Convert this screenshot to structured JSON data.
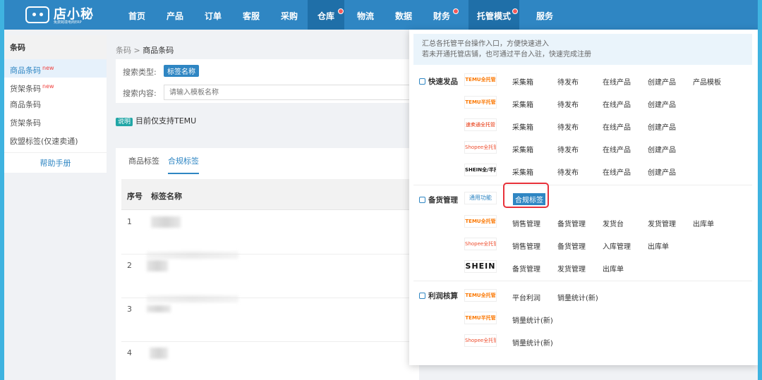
{
  "logo": {
    "name": "店小秘",
    "sub": "免费跨境电商ERP"
  },
  "nav": {
    "items": [
      {
        "label": "首页"
      },
      {
        "label": "产品"
      },
      {
        "label": "订单"
      },
      {
        "label": "客服"
      },
      {
        "label": "采购"
      },
      {
        "label": "仓库"
      },
      {
        "label": "物流"
      },
      {
        "label": "数据"
      },
      {
        "label": "财务"
      },
      {
        "label": "托管模式"
      },
      {
        "label": "服务"
      }
    ],
    "active": "托管模式"
  },
  "sidebar": {
    "title": "条码",
    "items": [
      {
        "label": "商品条码",
        "badge": "new"
      },
      {
        "label": "货架条码",
        "badge": "new"
      },
      {
        "label": "商品条码"
      },
      {
        "label": "货架条码"
      },
      {
        "label": "欧盟标签(仅速卖通)"
      }
    ],
    "help": "帮助手册"
  },
  "breadcrumb": {
    "parent": "条码",
    "sep": ">",
    "current": "商品条码"
  },
  "filter": {
    "type_label": "搜索类型:",
    "type_value": "标签名称",
    "content_label": "搜索内容:",
    "placeholder": "请输入模板名称"
  },
  "note": {
    "tag": "说明",
    "text": "目前仅支持TEMU"
  },
  "tabs": [
    {
      "label": "商品标签"
    },
    {
      "label": "合规标签"
    }
  ],
  "table": {
    "headers": {
      "num": "序号",
      "name": "标签名称"
    },
    "rows": [
      {
        "num": "1"
      },
      {
        "num": "2"
      },
      {
        "num": "3"
      },
      {
        "num": "4"
      }
    ]
  },
  "dropdown": {
    "banner": [
      "汇总各托管平台操作入口，方便快速进入",
      "若未开通托管店铺，也可通过平台入驻，快速完成注册"
    ],
    "sections": {
      "quick": "快速发品",
      "stock": "备货管理",
      "profit": "利润核算"
    },
    "platforms": {
      "temu_full": "TEMU全托管",
      "temu_semi": "TEMU半托管",
      "ali": "速卖通全托管",
      "shopee": "Shopee全托管",
      "shein_semi": "SHEIN全/半托管",
      "shein": "SHEIN",
      "tool": "通用功能"
    },
    "quick_rows": [
      {
        "links": [
          "采集箱",
          "待发布",
          "在线产品",
          "创建产品",
          "产品模板"
        ]
      },
      {
        "links": [
          "采集箱",
          "待发布",
          "在线产品",
          "创建产品"
        ]
      },
      {
        "links": [
          "采集箱",
          "待发布",
          "在线产品",
          "创建产品"
        ]
      },
      {
        "links": [
          "采集箱",
          "待发布",
          "在线产品",
          "创建产品"
        ]
      },
      {
        "links": [
          "采集箱",
          "待发布",
          "在线产品",
          "创建产品"
        ]
      }
    ],
    "stock_tool": "合规标签",
    "stock_rows": [
      {
        "links": [
          "销售管理",
          "备货管理",
          "发货台",
          "发货管理",
          "出库单"
        ]
      },
      {
        "links": [
          "销售管理",
          "备货管理",
          "入库管理",
          "出库单"
        ]
      },
      {
        "links": [
          "备货管理",
          "发货管理",
          "出库单"
        ]
      }
    ],
    "profit_rows": [
      {
        "links": [
          "平台利润",
          "销量统计(新)"
        ]
      },
      {
        "links": [
          "销量统计(新)"
        ]
      },
      {
        "links": [
          "销量统计(新)"
        ]
      }
    ]
  },
  "colors": {
    "primary": "#2f86c3",
    "highlight": "#e8313a",
    "temu": "#fb7701"
  }
}
